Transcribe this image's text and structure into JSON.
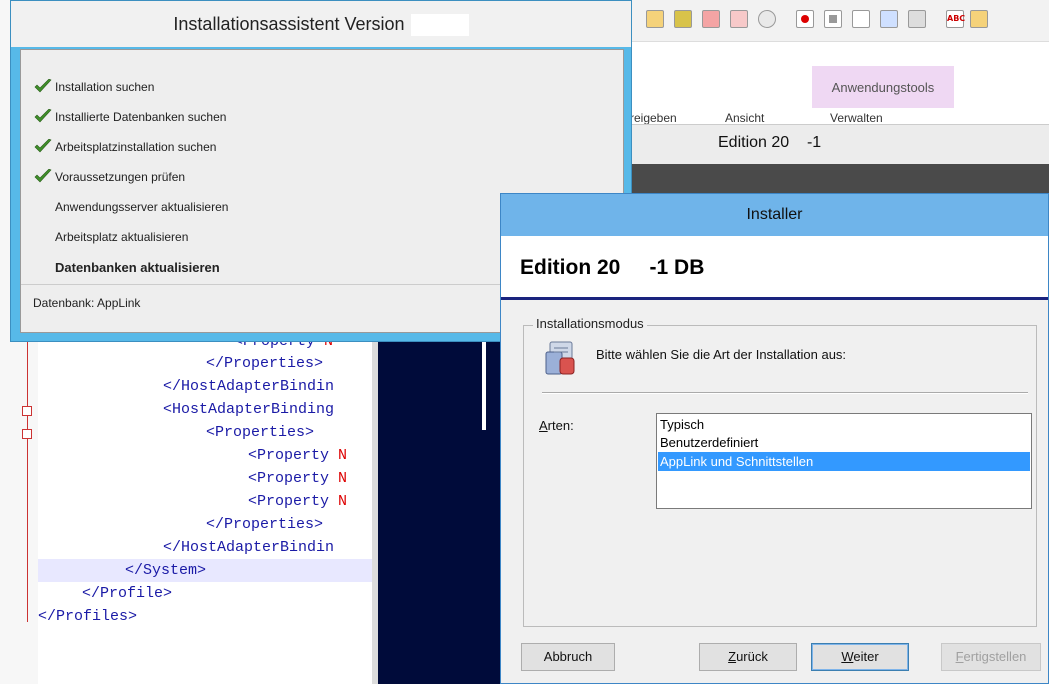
{
  "editor": {
    "lines": [
      {
        "text": "<Property ",
        "tail": "N"
      },
      {
        "text": "</Properties>",
        "tail": ""
      },
      {
        "text": "</HostAdapterBindin",
        "tail": ""
      },
      {
        "text": "<HostAdapterBinding",
        "tail": ""
      },
      {
        "text": "<Properties>",
        "tail": ""
      },
      {
        "text": "<Property ",
        "tail": "N"
      },
      {
        "text": "<Property ",
        "tail": "N"
      },
      {
        "text": "<Property ",
        "tail": "N"
      },
      {
        "text": "</Properties>",
        "tail": ""
      },
      {
        "text": "</HostAdapterBindin",
        "tail": ""
      },
      {
        "text": "</System>",
        "tail": ""
      },
      {
        "text": "</Profile>",
        "tail": ""
      },
      {
        "text": "</Profiles>",
        "tail": ""
      }
    ]
  },
  "background_app": {
    "ribbon_context_tab": "Anwendungstools",
    "ribbon_tabs": [
      "reigeben",
      "Ansicht",
      "Verwalten"
    ],
    "edition_bar": "Edition 20    -1"
  },
  "install_assistant": {
    "title": "Installationsassistent  Version",
    "steps": [
      {
        "label": "Installation suchen",
        "done": true
      },
      {
        "label": "Installierte Datenbanken suchen",
        "done": true
      },
      {
        "label": "Arbeitsplatzinstallation suchen",
        "done": true
      },
      {
        "label": "Voraussetzungen prüfen",
        "done": true
      },
      {
        "label": "Anwendungsserver aktualisieren",
        "done": false
      },
      {
        "label": "Arbeitsplatz aktualisieren",
        "done": false
      },
      {
        "label": "Datenbanken aktualisieren",
        "done": false,
        "current": true
      }
    ],
    "status": "Datenbank: AppLink"
  },
  "installer": {
    "title": "Installer",
    "heading": "Edition 20     -1 DB",
    "group_label": "Installationsmodus",
    "prompt": "Bitte wählen Sie die Art der Installation aus:",
    "types_label": "Arten:",
    "options": [
      "Typisch",
      "Benutzerdefiniert",
      "AppLink und Schnittstellen"
    ],
    "selected_option": "AppLink und Schnittstellen",
    "buttons": {
      "cancel": "Abbruch",
      "back": "Zurück",
      "next": "Weiter",
      "finish": "Fertigstellen"
    }
  },
  "colors": {
    "accent_blue": "#57b9e8",
    "selection": "#3399ff",
    "check_green": "#3f8f2a",
    "heading_rule": "#1a237e"
  }
}
